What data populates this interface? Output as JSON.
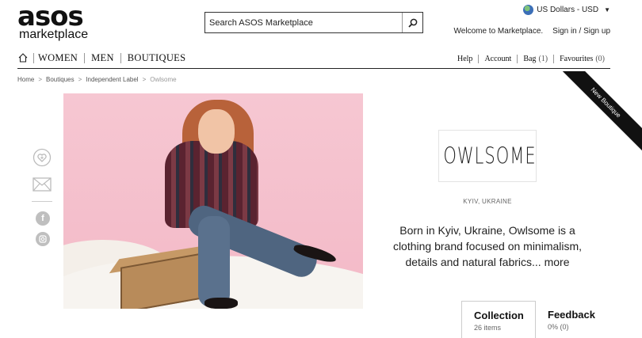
{
  "header": {
    "logo_main": "asos",
    "logo_sub": "marketplace",
    "search_placeholder": "Search ASOS Marketplace",
    "currency": "US Dollars - USD",
    "welcome": "Welcome to Marketplace.",
    "signin": "Sign in / Sign up"
  },
  "nav": {
    "items": [
      "WOMEN",
      "MEN",
      "BOUTIQUES"
    ],
    "right": {
      "help": "Help",
      "account": "Account",
      "bag": "Bag",
      "bag_count": "(1)",
      "favourites": "Favourites",
      "fav_count": "(0)"
    }
  },
  "breadcrumb": [
    "Home",
    "Boutiques",
    "Independent Label",
    "Owlsome"
  ],
  "brand": {
    "name": "OWLSOME",
    "ribbon": "New Boutique",
    "location": "KYIV, UKRAINE",
    "description": "Born in Kyiv, Ukraine, Owlsome is a clothing brand focused on minimalism, details and natural fabrics...",
    "more": "more"
  },
  "tabs": [
    {
      "title": "Collection",
      "sub": "26 items"
    },
    {
      "title": "Feedback",
      "sub": "0% (0)"
    }
  ],
  "icons": [
    "home-icon",
    "search-icon",
    "globe-icon",
    "heart-icon",
    "mail-icon",
    "facebook-icon",
    "instagram-icon"
  ]
}
